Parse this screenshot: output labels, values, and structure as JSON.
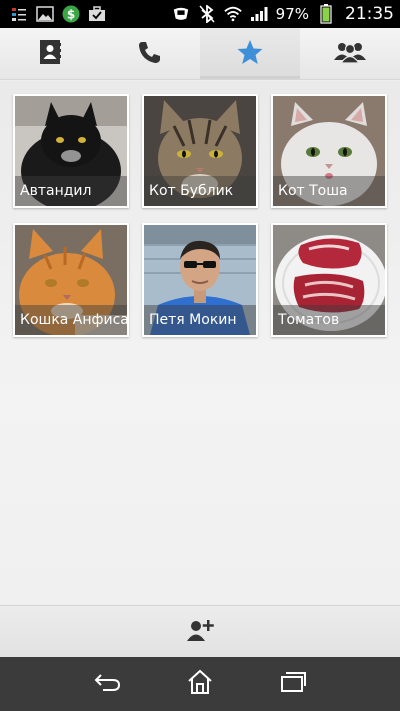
{
  "status_bar": {
    "battery_percent": "97%",
    "time": "21:35",
    "left_icons": [
      "list-icon",
      "image-icon",
      "dollar-icon",
      "briefcase-icon"
    ],
    "right_icons": [
      "nfc-icon",
      "bluetooth-icon",
      "wifi-icon",
      "signal-icon",
      "battery-icon"
    ]
  },
  "tabs": [
    {
      "icon": "contacts-book-icon",
      "active": false
    },
    {
      "icon": "phone-icon",
      "active": false
    },
    {
      "icon": "star-icon",
      "active": true
    },
    {
      "icon": "groups-icon",
      "active": false
    }
  ],
  "favorites": [
    {
      "name": "Автандил"
    },
    {
      "name": "Кот Бублик"
    },
    {
      "name": "Кот Тоша"
    },
    {
      "name": "Кошка Анфиса"
    },
    {
      "name": "Петя Мокин"
    },
    {
      "name": "Томатов"
    }
  ],
  "action_bar": {
    "icon": "add-contact-icon"
  },
  "nav_bar": {
    "icons": [
      "back-icon",
      "home-icon",
      "recent-apps-icon"
    ]
  },
  "colors": {
    "accent": "#3d8fd8",
    "status_bar": "#000000",
    "nav_bar": "#3b3b3b"
  }
}
